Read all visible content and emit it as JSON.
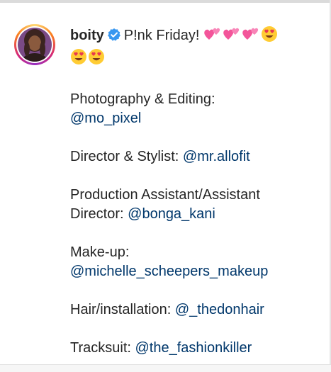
{
  "post": {
    "username": "boity",
    "headline": "P!nk Friday!",
    "headline_emojis": [
      "two-hearts",
      "two-hearts",
      "two-hearts",
      "heart-eyes"
    ],
    "second_line_emojis": [
      "heart-eyes",
      "heart-eyes"
    ],
    "credits": [
      {
        "label": "Photography & Editing:",
        "mention": "@mo_pixel"
      },
      {
        "label": "Director & Stylist:",
        "mention": "@mr.allofit"
      },
      {
        "label": "Production Assistant/Assistant Director:",
        "label_line1": "Production Assistant/Assistant",
        "label_line2": "Director:",
        "mention": "@bonga_kani"
      },
      {
        "label": "Make-up:",
        "mention": "@michelle_scheepers_makeup"
      },
      {
        "label": "Hair/installation:",
        "mention": "@_thedonhair"
      },
      {
        "label": "Tracksuit:",
        "mention": "@the_fashionkiller"
      }
    ]
  },
  "colors": {
    "text": "#262626",
    "mention": "#00376b",
    "verified": "#3897f0"
  }
}
